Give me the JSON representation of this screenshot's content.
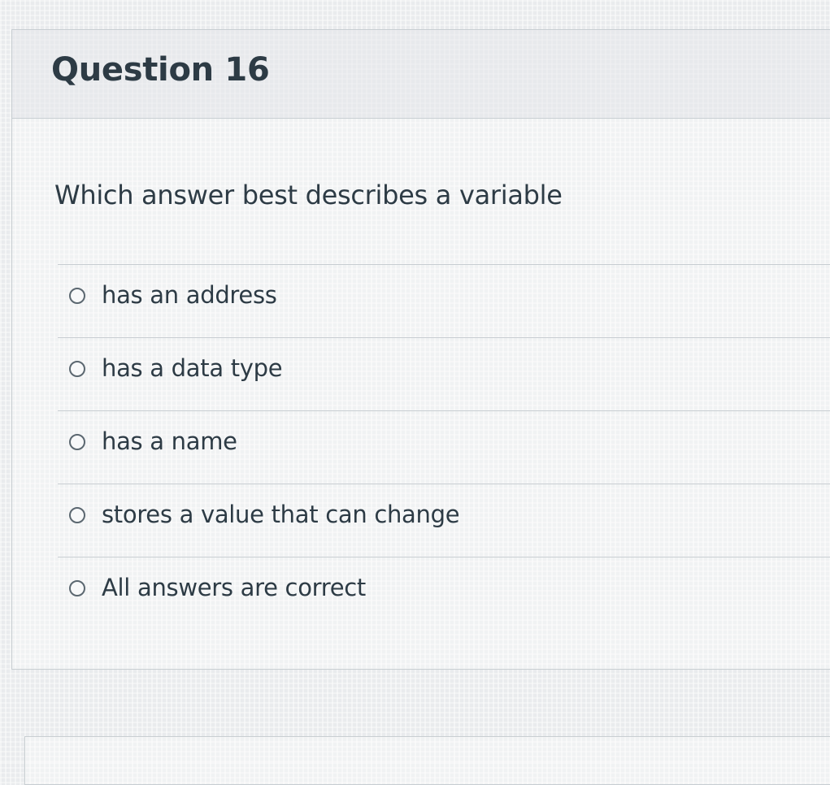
{
  "question": {
    "title": "Question 16",
    "text": "Which answer best describes a variable",
    "answers": [
      {
        "label": "has an address"
      },
      {
        "label": "has a data type"
      },
      {
        "label": "has a name"
      },
      {
        "label": "stores a value that can change"
      },
      {
        "label": "All answers are correct"
      }
    ]
  },
  "colors": {
    "text": "#2d3b45",
    "border": "#c7cdd1",
    "radio_border": "#5b6770"
  }
}
